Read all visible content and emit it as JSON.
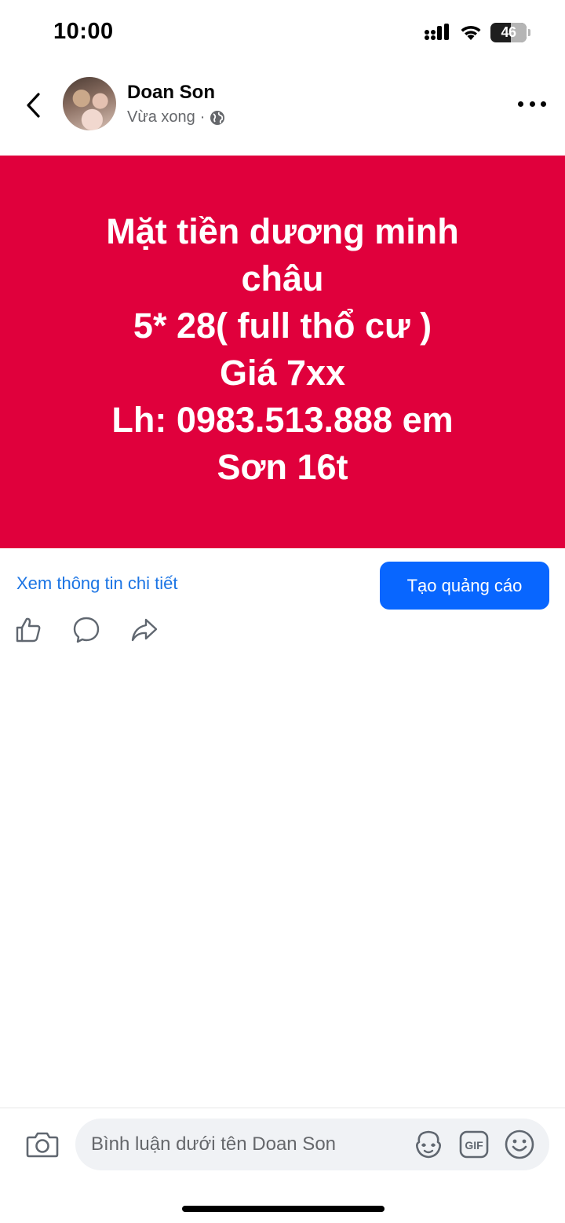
{
  "status_bar": {
    "time": "10:00",
    "battery_level": "46",
    "icons": [
      "signal-icon",
      "wifi-icon",
      "battery-icon"
    ]
  },
  "header": {
    "author_name": "Doan Son",
    "timestamp": "Vừa xong",
    "separator": "·",
    "privacy_icon": "globe-icon"
  },
  "post": {
    "banner_text": "Mặt tiền dương minh\nchâu\n5* 28( full thổ cư )\nGiá 7xx\nLh: 0983.513.888 em\nSơn 16t",
    "banner_color": "#e0003c"
  },
  "actions": {
    "see_details_label": "Xem thông tin chi tiết",
    "create_ad_label": "Tạo quảng cáo",
    "reaction_icons": [
      "like-icon",
      "comment-icon",
      "share-icon"
    ]
  },
  "comment_bar": {
    "placeholder": "Bình luận dưới tên Doan Son",
    "icons": [
      "camera-icon",
      "avatar-sticker-icon",
      "gif-icon",
      "emoji-icon"
    ]
  },
  "colors": {
    "accent": "#0866ff",
    "link": "#1b74e4",
    "secondary_text": "#65676b"
  }
}
